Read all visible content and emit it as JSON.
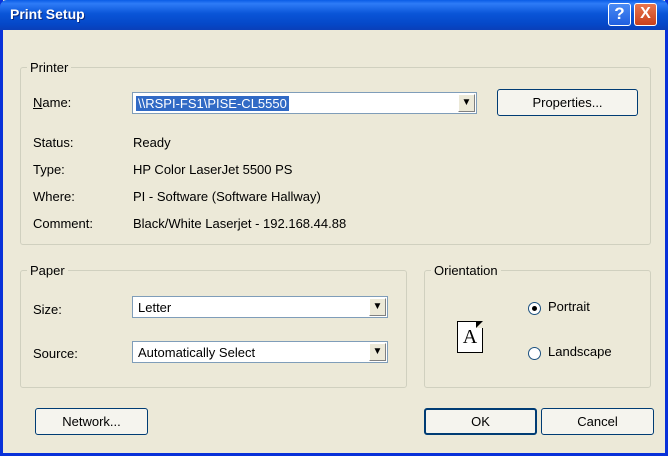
{
  "window": {
    "title": "Print Setup",
    "help_label": "?",
    "close_label": "X"
  },
  "printer": {
    "group_label": "Printer",
    "name_label_pre": "",
    "name_label_key": "N",
    "name_label_post": "ame:",
    "name_value": "\\\\RSPI-FS1\\PISE-CL5550",
    "properties_button": "Properties...",
    "status_label": "Status:",
    "status_value": "Ready",
    "type_label": "Type:",
    "type_value": "HP Color LaserJet 5500 PS",
    "where_label": "Where:",
    "where_value": "PI - Software (Software Hallway)",
    "comment_label": "Comment:",
    "comment_value": "Black/White Laserjet - 192.168.44.88"
  },
  "paper": {
    "group_label": "Paper",
    "size_label": "Size:",
    "size_value": "Letter",
    "source_label": "Source:",
    "source_value": "Automatically Select"
  },
  "orientation": {
    "group_label": "Orientation",
    "portrait_label": "Portrait",
    "landscape_label": "Landscape",
    "selected": "portrait",
    "page_icon_letter": "A"
  },
  "buttons": {
    "network": "Network...",
    "ok": "OK",
    "cancel": "Cancel"
  },
  "colors": {
    "titlebar": "#0a55d8",
    "dialog_bg": "#ece9d8",
    "selection": "#316ac5"
  }
}
